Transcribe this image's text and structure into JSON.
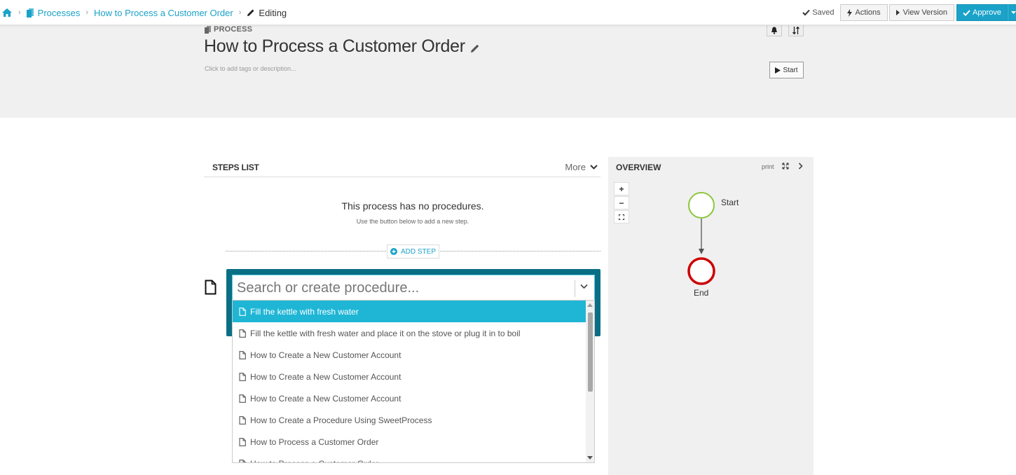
{
  "breadcrumb": {
    "processes": "Processes",
    "process_name": "How to Process a Customer Order",
    "editing": "Editing"
  },
  "toolbar": {
    "saved": "Saved",
    "actions": "Actions",
    "view_version": "View Version",
    "approve": "Approve"
  },
  "header": {
    "type_label": "PROCESS",
    "title": "How to Process a Customer Order",
    "description_placeholder": "Click to add tags or description...",
    "start_button": "Start"
  },
  "steps": {
    "heading": "STEPS LIST",
    "more": "More",
    "empty_title": "This process has no procedures.",
    "empty_subtitle": "Use the button below to add a new step.",
    "add_step": "ADD STEP"
  },
  "search": {
    "placeholder": "Search or create procedure...",
    "options": [
      "Fill the kettle with fresh water",
      "Fill the kettle with fresh water and place it on the stove or plug it in to boil",
      "How to Create a New Customer Account",
      "How to Create a New Customer Account",
      "How to Create a New Customer Account",
      "How to Create a Procedure Using SweetProcess",
      "How to Process a Customer Order",
      "How to Process a Customer Order"
    ],
    "highlighted_index": 0
  },
  "overview": {
    "title": "OVERVIEW",
    "print": "print",
    "zoom_in": "+",
    "zoom_out": "−",
    "start_node": "Start",
    "end_node": "End"
  },
  "colors": {
    "accent": "#1aa2c8",
    "highlight": "#1fb6d6",
    "combo_border": "#0a6f85",
    "start_node": "#8cc63f",
    "end_node": "#cc0000"
  }
}
